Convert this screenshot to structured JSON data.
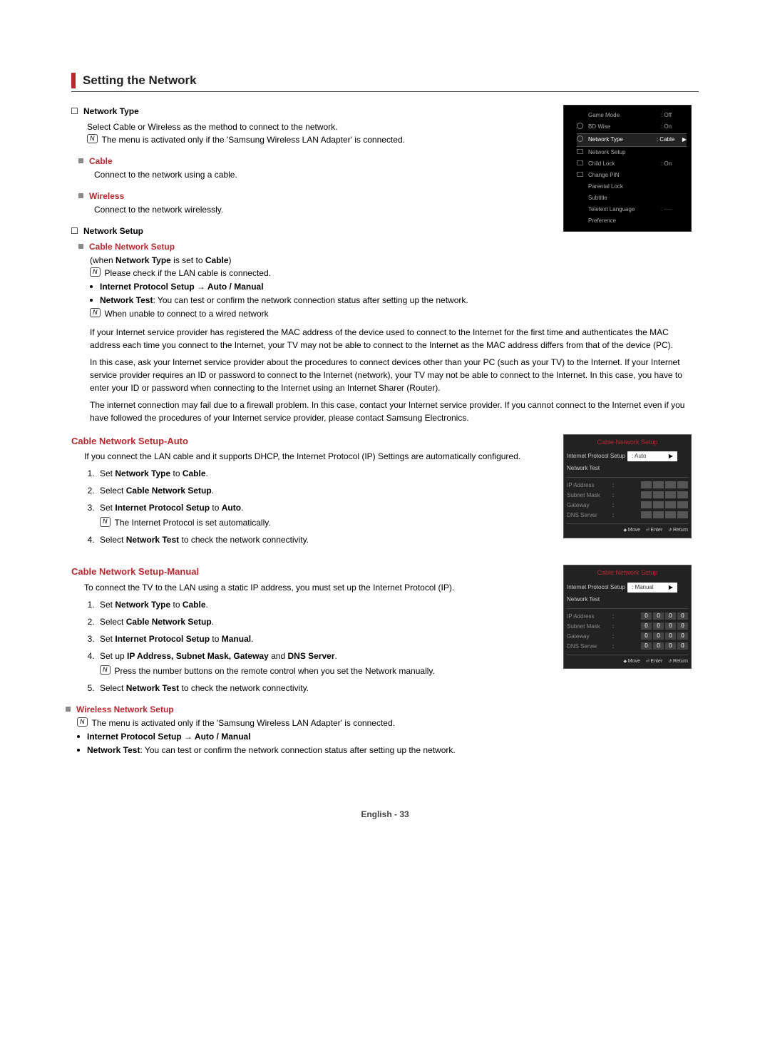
{
  "sectionTitle": "Setting the Network",
  "networkType": {
    "heading": "Network Type",
    "desc": "Select Cable or Wireless as the method to connect to the network.",
    "note": "The menu is activated only if the 'Samsung Wireless LAN Adapter' is connected.",
    "items": [
      {
        "label": "Cable",
        "text": "Connect to the network using a cable."
      },
      {
        "label": "Wireless",
        "text": "Connect to the network wirelessly."
      }
    ]
  },
  "networkSetup": {
    "heading": "Network Setup",
    "cable": {
      "label": "Cable Network Setup",
      "when_prefix": "(when ",
      "when_bold1": "Network Type",
      "when_mid": " is set to ",
      "when_bold2": "Cable",
      "when_suffix": ")",
      "note1": "Please check if the LAN cable is connected.",
      "ips": "Internet Protocol Setup → Auto / Manual",
      "ntest_bold": "Network Test",
      "ntest_text": ": You can test or confirm the network connection status after setting up the network.",
      "note2": "When unable to connect to a wired network",
      "p1": "If your Internet service provider has registered the MAC address of the device used to connect to the Internet for the first time and authenticates the MAC address each time you connect to the Internet, your TV may not be able to connect to the Internet as the MAC address differs from that of the device (PC).",
      "p2": "In this case, ask your Internet service provider about the procedures to connect devices other than your PC (such as your TV) to the Internet. If your Internet service provider requires an ID or password to connect to the Internet (network), your TV may not be able to connect to the Internet. In this case, you have to enter your ID or password when connecting to the Internet using an Internet Sharer (Router).",
      "p3": "The internet connection may fail due to a firewall problem. In this case, contact your Internet service provider. If you cannot connect to the Internet even if you have followed the procedures of your Internet service provider, please contact Samsung Electronics."
    }
  },
  "cnsAuto": {
    "title": "Cable Network Setup-Auto",
    "intro": "If you connect the LAN cable and it supports DHCP, the Internet Protocol (IP) Settings are automatically configured.",
    "steps": [
      {
        "pre": "Set ",
        "bold": "Network Type",
        "mid": " to ",
        "bold2": "Cable",
        "post": "."
      },
      {
        "pre": "Select ",
        "bold": "Cable Network Setup",
        "post": "."
      },
      {
        "pre": "Set ",
        "bold": "Internet Protocol Setup",
        "mid": " to ",
        "bold2": "Auto",
        "post": ".",
        "note": "The Internet Protocol is set automatically."
      },
      {
        "pre": "Select ",
        "bold": "Network Test",
        "post": " to check the network connectivity."
      }
    ]
  },
  "cnsManual": {
    "title": "Cable Network Setup-Manual",
    "intro": "To connect the TV to the LAN using a static IP address, you must set up the Internet Protocol (IP).",
    "steps": [
      {
        "pre": "Set ",
        "bold": "Network Type",
        "mid": " to ",
        "bold2": "Cable",
        "post": "."
      },
      {
        "pre": "Select ",
        "bold": "Cable Network Setup",
        "post": "."
      },
      {
        "pre": "Set ",
        "bold": "Internet Protocol Setup",
        "mid": " to ",
        "bold2": "Manual",
        "post": "."
      },
      {
        "pre": "Set up ",
        "bold": "IP Address, Subnet Mask, Gateway",
        "mid": " and ",
        "bold2": "DNS Server",
        "post": ".",
        "note": "Press the number buttons on the remote control when you set the Network manually."
      },
      {
        "pre": "Select ",
        "bold": "Network Test",
        "post": " to check the network connectivity."
      }
    ]
  },
  "wirelessSetup": {
    "label": "Wireless Network Setup",
    "note": "The menu is activated only if the 'Samsung Wireless LAN Adapter' is connected.",
    "ips": "Internet Protocol Setup → Auto / Manual",
    "ntest_bold": "Network Test",
    "ntest_text": ": You can test or confirm the network connection status after setting up the network."
  },
  "tvMenu": {
    "rows": [
      {
        "label": "Game Mode",
        "val": ": Off"
      },
      {
        "label": "BD Wise",
        "val": ": On"
      }
    ],
    "highlight": {
      "label": "Network Type",
      "val": ": Cable"
    },
    "rows2": [
      {
        "label": "Network Setup",
        "val": ""
      },
      {
        "label": "Child Lock",
        "val": ": On"
      },
      {
        "label": "Change PIN",
        "val": ""
      },
      {
        "label": "Parental Lock",
        "val": ""
      },
      {
        "label": "Subtitle",
        "val": ""
      },
      {
        "label": "Teletext Language",
        "val": ": ----"
      },
      {
        "label": "Preference",
        "val": ""
      }
    ]
  },
  "popupAuto": {
    "title": "Cable Network Setup",
    "ips": "Internet Protocol Setup",
    "val": ": Auto",
    "ntest": "Network Test",
    "fields": [
      "IP Address",
      "Subnet Mask",
      "Gateway",
      "DNS Server"
    ],
    "footer": {
      "move": "Move",
      "enter": "Enter",
      "return": "Return"
    }
  },
  "popupManual": {
    "title": "Cable Network Setup",
    "ips": "Internet Protocol Setup",
    "val": ": Manual",
    "ntest": "Network Test",
    "fields": [
      "IP Address",
      "Subnet Mask",
      "Gateway",
      "DNS Server"
    ],
    "zero": "0",
    "footer": {
      "move": "Move",
      "enter": "Enter",
      "return": "Return"
    }
  },
  "pageFooter": "English - 33",
  "noteGlyph": "N"
}
